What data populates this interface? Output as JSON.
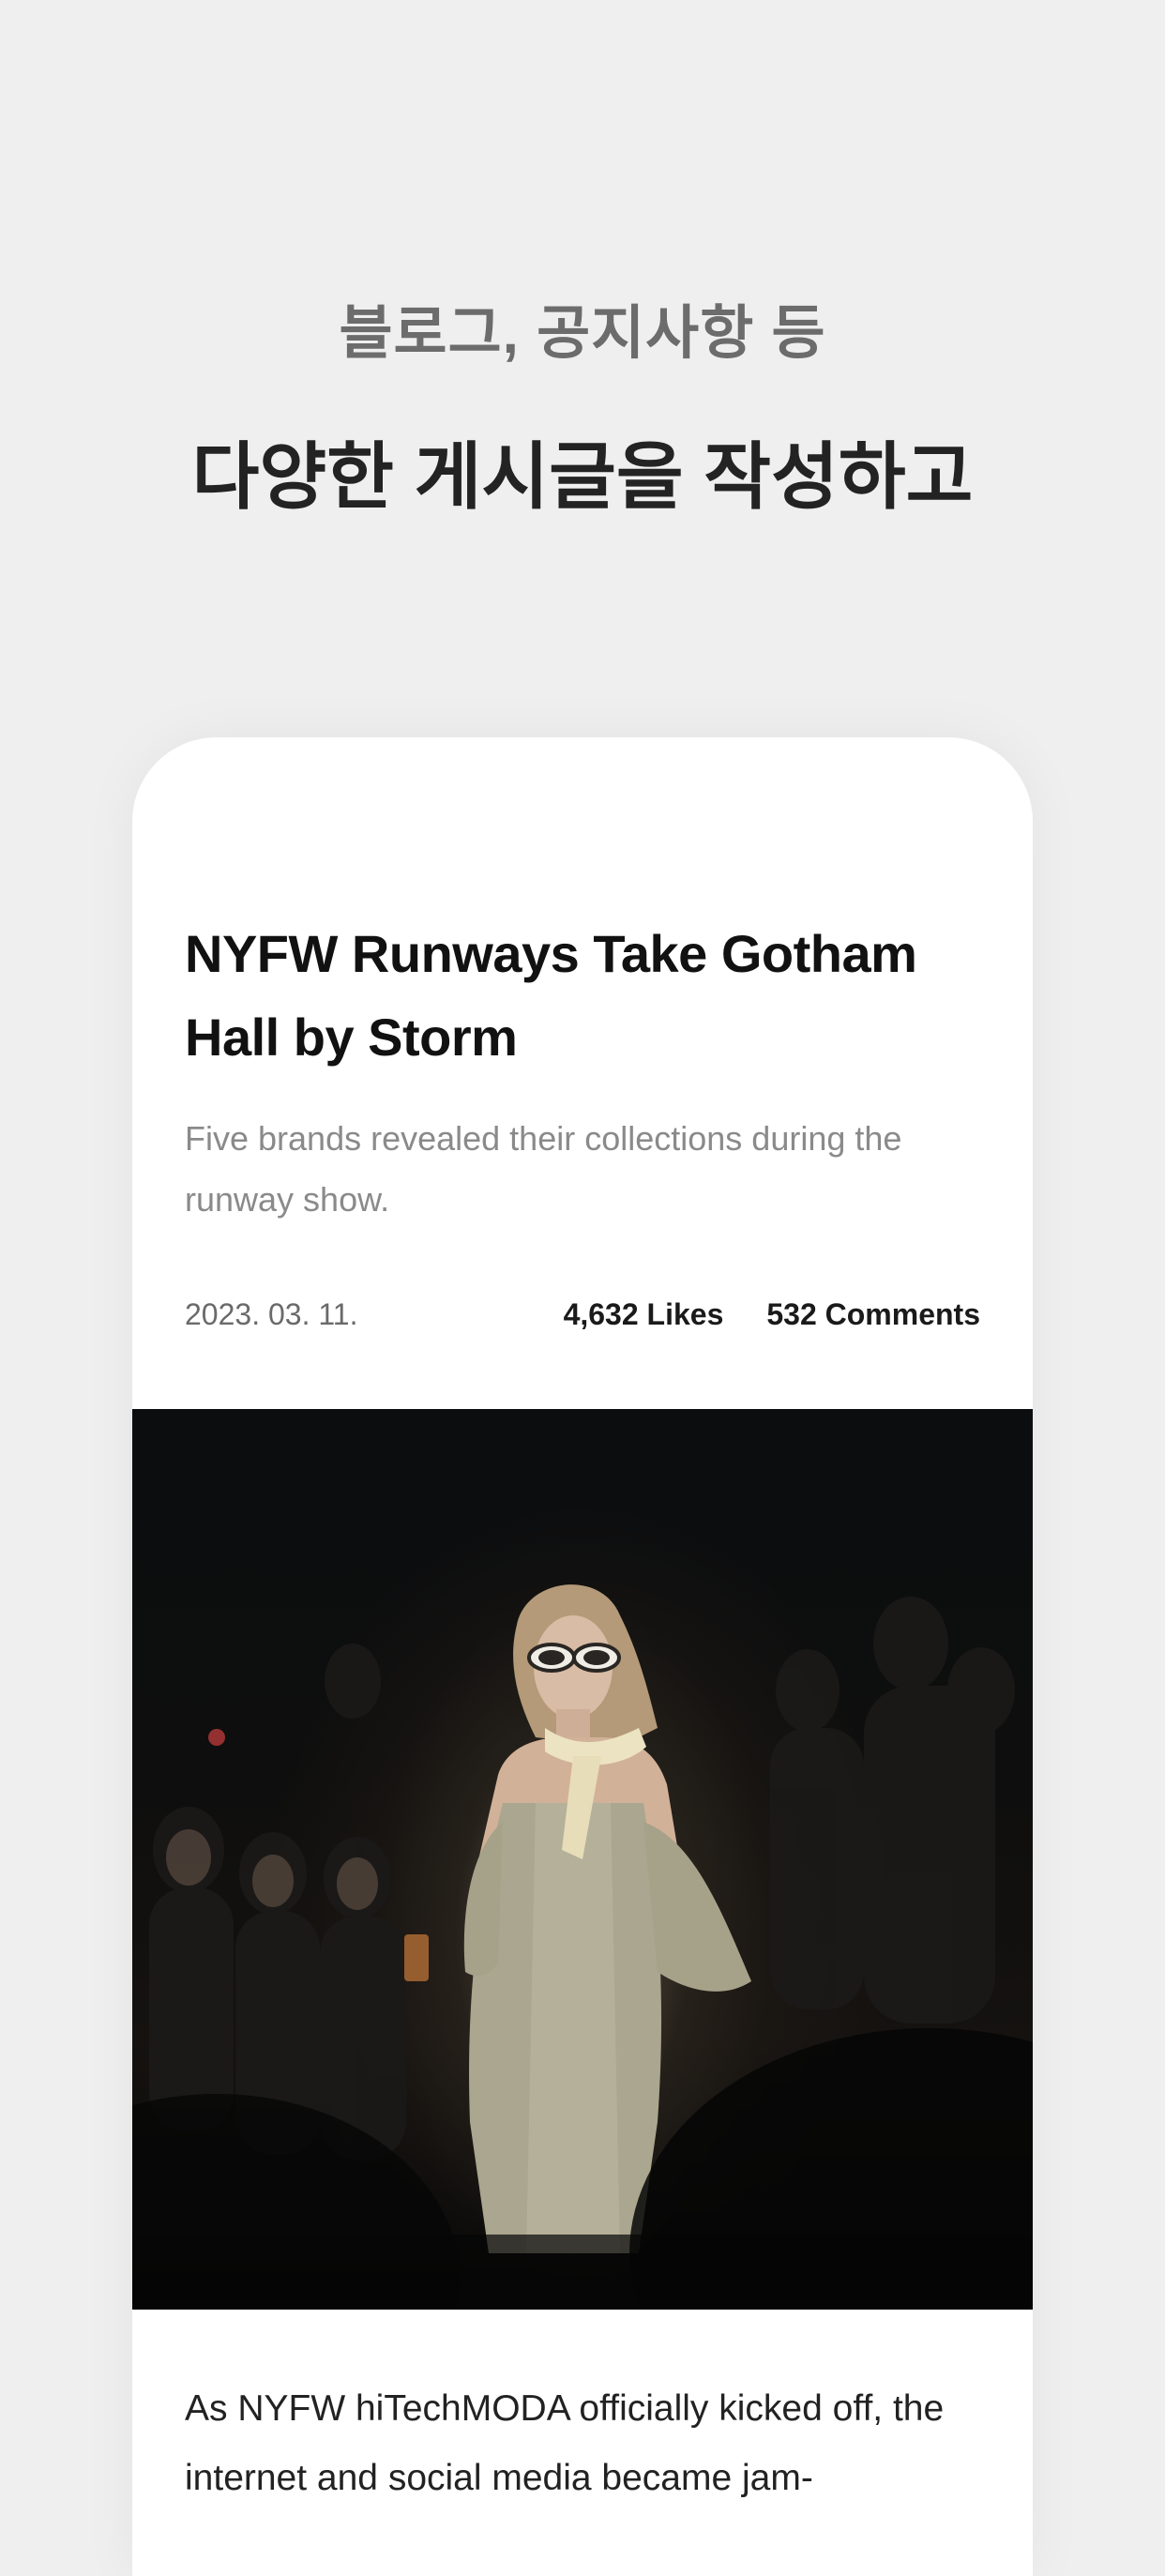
{
  "headline": {
    "subtitle": "블로그, 공지사항 등",
    "title": "다양한 게시글을 작성하고"
  },
  "post": {
    "title": "NYFW Runways Take Gotham Hall by Storm",
    "summary": "Five brands revealed their collections during the runway show.",
    "date": "2023. 03. 11.",
    "likes": "4,632 Likes",
    "comments": "532 Comments",
    "image_icon": "runway-model-photo",
    "body": "As NYFW hiTechMODA officially kicked off, the internet and social media became jam-"
  },
  "colors": {
    "background": "#efefef",
    "card": "#ffffff",
    "title_text": "#111111",
    "muted_text": "#8a8a8a"
  }
}
